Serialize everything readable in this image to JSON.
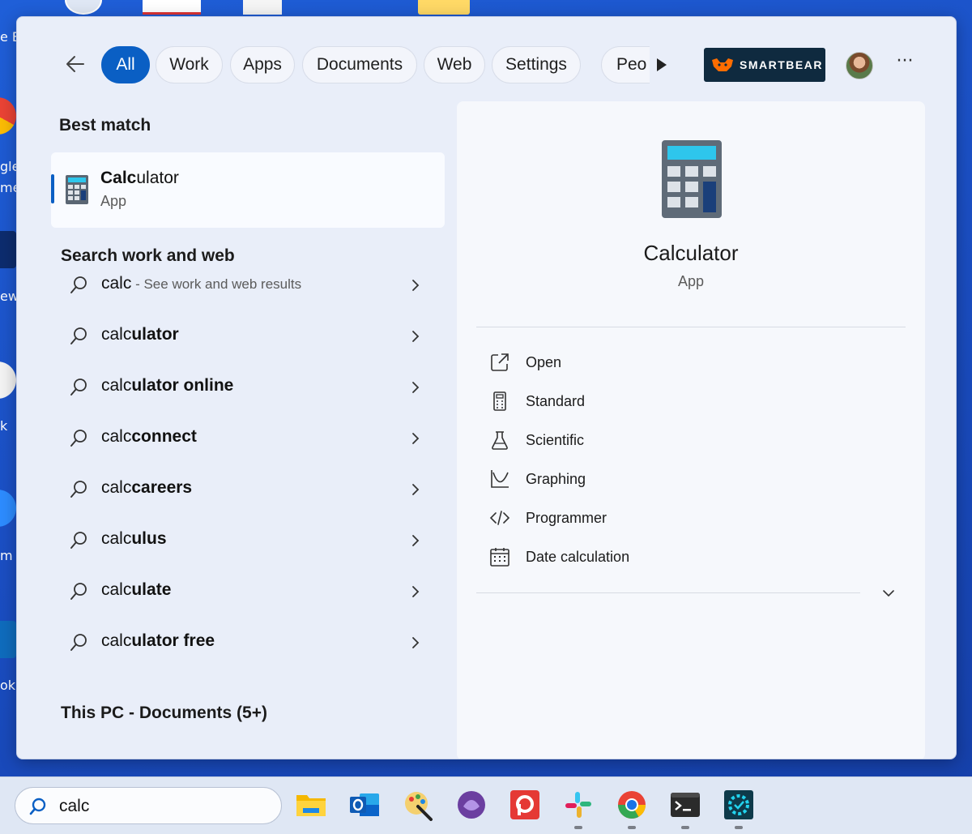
{
  "desktop": {
    "left_labels": [
      "e Bi",
      "gle",
      "me",
      "ew",
      "k",
      "m",
      "m",
      "ok"
    ],
    "top_icons": [
      "shortcut-icon",
      "recorder-icon",
      "document-icon",
      "folder-icon"
    ]
  },
  "filters": {
    "back_icon": "back-arrow-icon",
    "tabs": [
      {
        "label": "All",
        "active": true
      },
      {
        "label": "Work"
      },
      {
        "label": "Apps"
      },
      {
        "label": "Documents"
      },
      {
        "label": "Web"
      },
      {
        "label": "Settings"
      },
      {
        "label": "Peo"
      }
    ],
    "more_tabs_icon": "play-icon",
    "org_logo_text": "SMARTBEAR",
    "more_label": "···"
  },
  "best_match": {
    "heading": "Best match",
    "name_match": "Calc",
    "name_rest": "ulator",
    "type": "App"
  },
  "search_web": {
    "heading": "Search work and web",
    "suggestions": [
      {
        "prefix": "calc",
        "rest": "",
        "hint": " - See work and web results"
      },
      {
        "prefix": "calc",
        "rest": "ulator",
        "hint": ""
      },
      {
        "prefix": "calc",
        "rest": "ulator online",
        "hint": ""
      },
      {
        "prefix": "calc",
        "rest": "connect",
        "hint": ""
      },
      {
        "prefix": "calc",
        "rest": "careers",
        "hint": ""
      },
      {
        "prefix": "calc",
        "rest": "ulus",
        "hint": ""
      },
      {
        "prefix": "calc",
        "rest": "ulate",
        "hint": ""
      },
      {
        "prefix": "calc",
        "rest": "ulator free",
        "hint": ""
      }
    ]
  },
  "documents": {
    "heading": "This PC - Documents (5+)"
  },
  "detail": {
    "title": "Calculator",
    "subtitle": "App",
    "actions": [
      {
        "label": "Open",
        "icon": "open-external-icon"
      },
      {
        "label": "Standard",
        "icon": "calculator-icon"
      },
      {
        "label": "Scientific",
        "icon": "flask-icon"
      },
      {
        "label": "Graphing",
        "icon": "graph-icon"
      },
      {
        "label": "Programmer",
        "icon": "code-icon"
      },
      {
        "label": "Date calculation",
        "icon": "calendar-icon"
      }
    ]
  },
  "taskbar": {
    "search_value": "calc",
    "apps": [
      "file-explorer",
      "outlook",
      "paint",
      "visual-studio",
      "pocket-casts",
      "slack",
      "chrome",
      "terminal",
      "settings-gear"
    ]
  },
  "colors": {
    "accent": "#0a5fc4",
    "panel": "#e9eef9",
    "detail": "#f6f8fc"
  }
}
